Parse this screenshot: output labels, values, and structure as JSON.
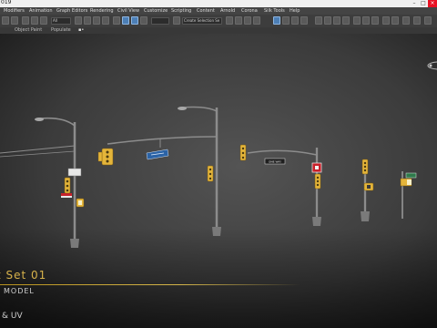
{
  "window": {
    "title": "019"
  },
  "menu": {
    "items": [
      "Modifiers",
      "Animation",
      "Graph Editors",
      "Rendering",
      "Civil View",
      "Customize",
      "Scripting",
      "Content",
      "Arnold",
      "Corona",
      "Silk Tools",
      "Help"
    ]
  },
  "toolbar": {
    "selection_filter": "All",
    "named_selection": "Create Selection Se"
  },
  "ribbon": {
    "tab_object_paint": "Object Paint",
    "tab_populate": "Populate"
  },
  "viewport": {
    "caption_title": "t Set 01",
    "caption_model": "MODEL",
    "caption_uv": "& UV",
    "signs": {
      "one_way": "ONE WAY"
    }
  },
  "colors": {
    "accent_gold": "#d4b54a",
    "pole_gray": "#8c8c8c",
    "signal_yellow": "#e4b53a",
    "sign_blue": "#2b63a6",
    "sign_red": "#c8202a",
    "sign_green": "#2f7a4b",
    "toolbar_highlight": "#4c7fb6"
  }
}
